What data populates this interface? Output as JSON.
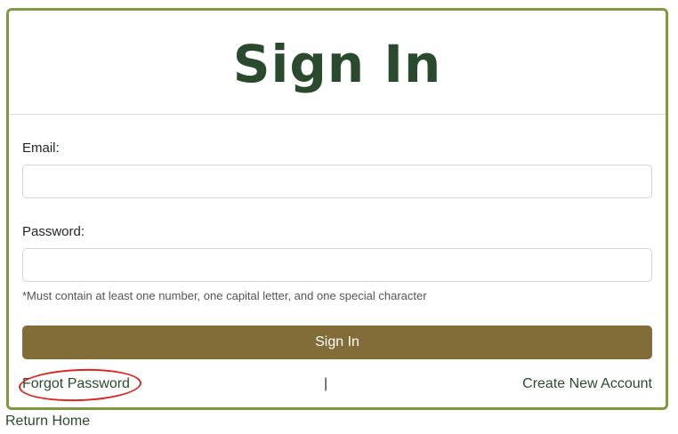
{
  "header": {
    "title": "Sign In"
  },
  "form": {
    "email_label": "Email:",
    "email_value": "",
    "password_label": "Password:",
    "password_value": "",
    "password_hint": "*Must contain at least one number, one capital letter, and one special character",
    "submit_label": "Sign In"
  },
  "footer": {
    "forgot_label": "Forgot Password",
    "separator": "|",
    "create_label": "Create New Account",
    "return_label": "Return Home"
  },
  "colors": {
    "card_border": "#7f9a3f",
    "title": "#2a4a2e",
    "button": "#826c37",
    "annotation": "#e0231d"
  }
}
